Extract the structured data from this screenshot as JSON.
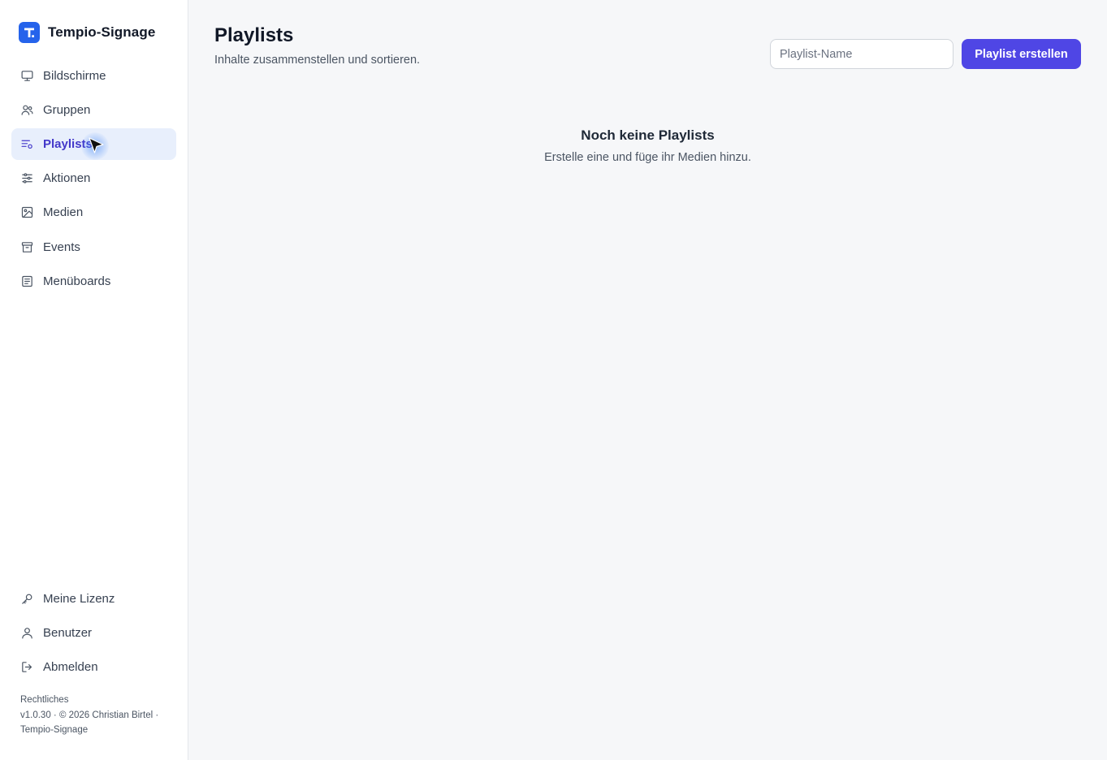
{
  "app": {
    "name": "Tempio-Signage",
    "logo_letter": "T",
    "brand_color": "#2563eb",
    "accent_color": "#4f46e5"
  },
  "sidebar": {
    "items": [
      {
        "label": "Bildschirme",
        "icon": "monitor-icon"
      },
      {
        "label": "Gruppen",
        "icon": "users-icon"
      },
      {
        "label": "Playlists",
        "icon": "playlist-icon",
        "active": true
      },
      {
        "label": "Aktionen",
        "icon": "sliders-icon"
      },
      {
        "label": "Medien",
        "icon": "image-icon"
      },
      {
        "label": "Events",
        "icon": "archive-icon"
      },
      {
        "label": "Menüboards",
        "icon": "document-icon"
      }
    ],
    "bottom_items": [
      {
        "label": "Meine Lizenz",
        "icon": "key-icon"
      },
      {
        "label": "Benutzer",
        "icon": "user-icon"
      },
      {
        "label": "Abmelden",
        "icon": "logout-icon"
      }
    ],
    "footer": {
      "legal_link": "Rechtliches",
      "copyright": "v1.0.30 · © 2026 Christian Birtel ·",
      "product": "Tempio-Signage"
    }
  },
  "main": {
    "title": "Playlists",
    "subtitle": "Inhalte zusammenstellen und sortieren.",
    "name_input": {
      "placeholder": "Playlist-Name",
      "value": ""
    },
    "create_button": "Playlist erstellen",
    "empty_state": {
      "title": "Noch keine Playlists",
      "text": "Erstelle eine und füge ihr Medien hinzu."
    }
  }
}
